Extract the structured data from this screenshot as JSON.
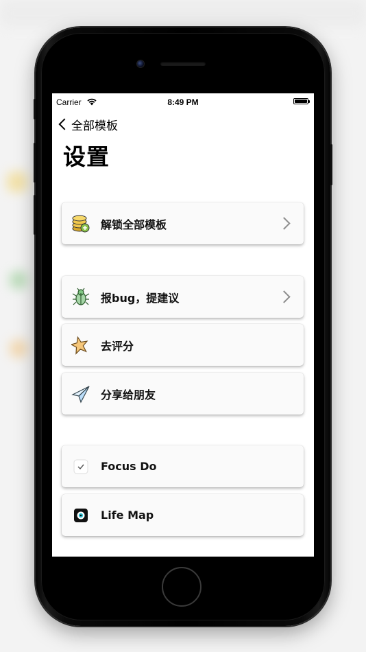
{
  "status_bar": {
    "carrier": "Carrier",
    "time": "8:49 PM",
    "battery": 1.0
  },
  "nav": {
    "back_label": "全部模板"
  },
  "page": {
    "title": "设置"
  },
  "items": [
    {
      "label": "解锁全部模板",
      "icon": "coins-unlock-icon",
      "chevron": true
    },
    {
      "label": "报bug，提建议",
      "icon": "bug-icon",
      "chevron": true
    },
    {
      "label": "去评分",
      "icon": "star-icon",
      "chevron": false
    },
    {
      "label": "分享给朋友",
      "icon": "paper-plane-icon",
      "chevron": false
    },
    {
      "label": "Focus Do",
      "icon": "focus-do-app-icon",
      "chevron": false
    },
    {
      "label": "Life Map",
      "icon": "life-map-app-icon",
      "chevron": false
    }
  ]
}
